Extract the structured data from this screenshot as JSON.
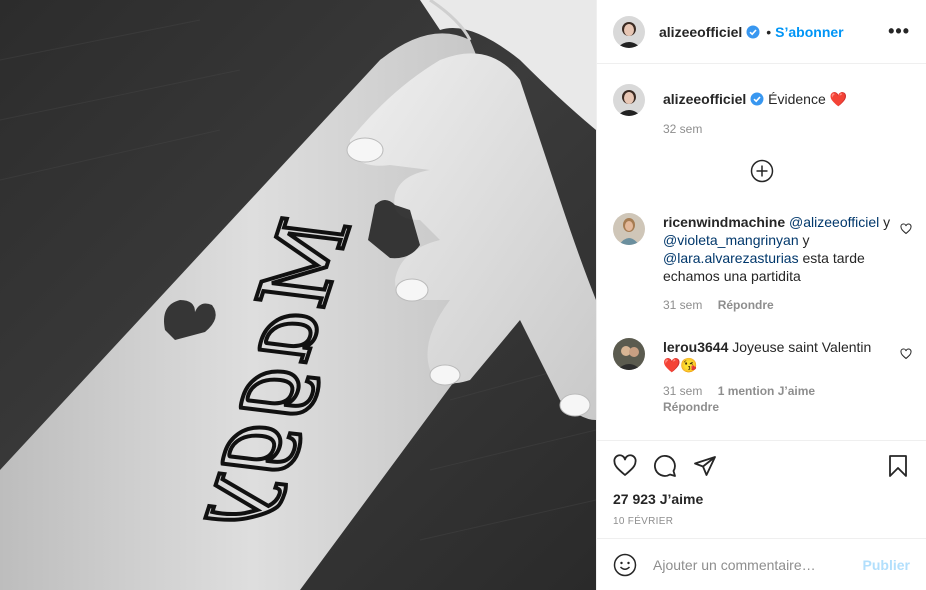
{
  "post": {
    "username": "alizeeofficiel",
    "follow_label": "S’abonner",
    "dot": "•",
    "more": "•••",
    "tattoo_text": "Maggy"
  },
  "caption": {
    "username": "alizeeofficiel",
    "text": "Évidence ❤️",
    "time": "32 sem"
  },
  "comments": [
    {
      "username": "ricenwindmachine",
      "mention1": "@alizeeofficiel",
      "sep1": " y ",
      "mention2": "@violeta_mangrinyan",
      "sep2": " y ",
      "mention3": "@lara.alvarezasturias",
      "text": " esta tarde echamos una partidita",
      "time": "31 sem",
      "reply": "Répondre"
    },
    {
      "username": "lerou3644",
      "text": "Joyeuse saint Valentin ❤️😘",
      "time": "31 sem",
      "likes": "1 mention J’aime",
      "reply": "Répondre"
    }
  ],
  "footer": {
    "likes": "27 923 J’aime",
    "date": "10 FÉVRIER",
    "comment_placeholder": "Ajouter un commentaire…",
    "publish": "Publier"
  },
  "colors": {
    "accent": "#0095f6",
    "publish_disabled": "#b2dffc",
    "muted": "#8e8e8e",
    "mention": "#00376b",
    "verified": "#3897f0"
  },
  "icons": [
    "verified-badge-icon",
    "more-options-icon",
    "load-more-comments-icon",
    "like-heart-icon",
    "comment-icon",
    "share-icon",
    "save-bookmark-icon",
    "emoji-icon"
  ]
}
